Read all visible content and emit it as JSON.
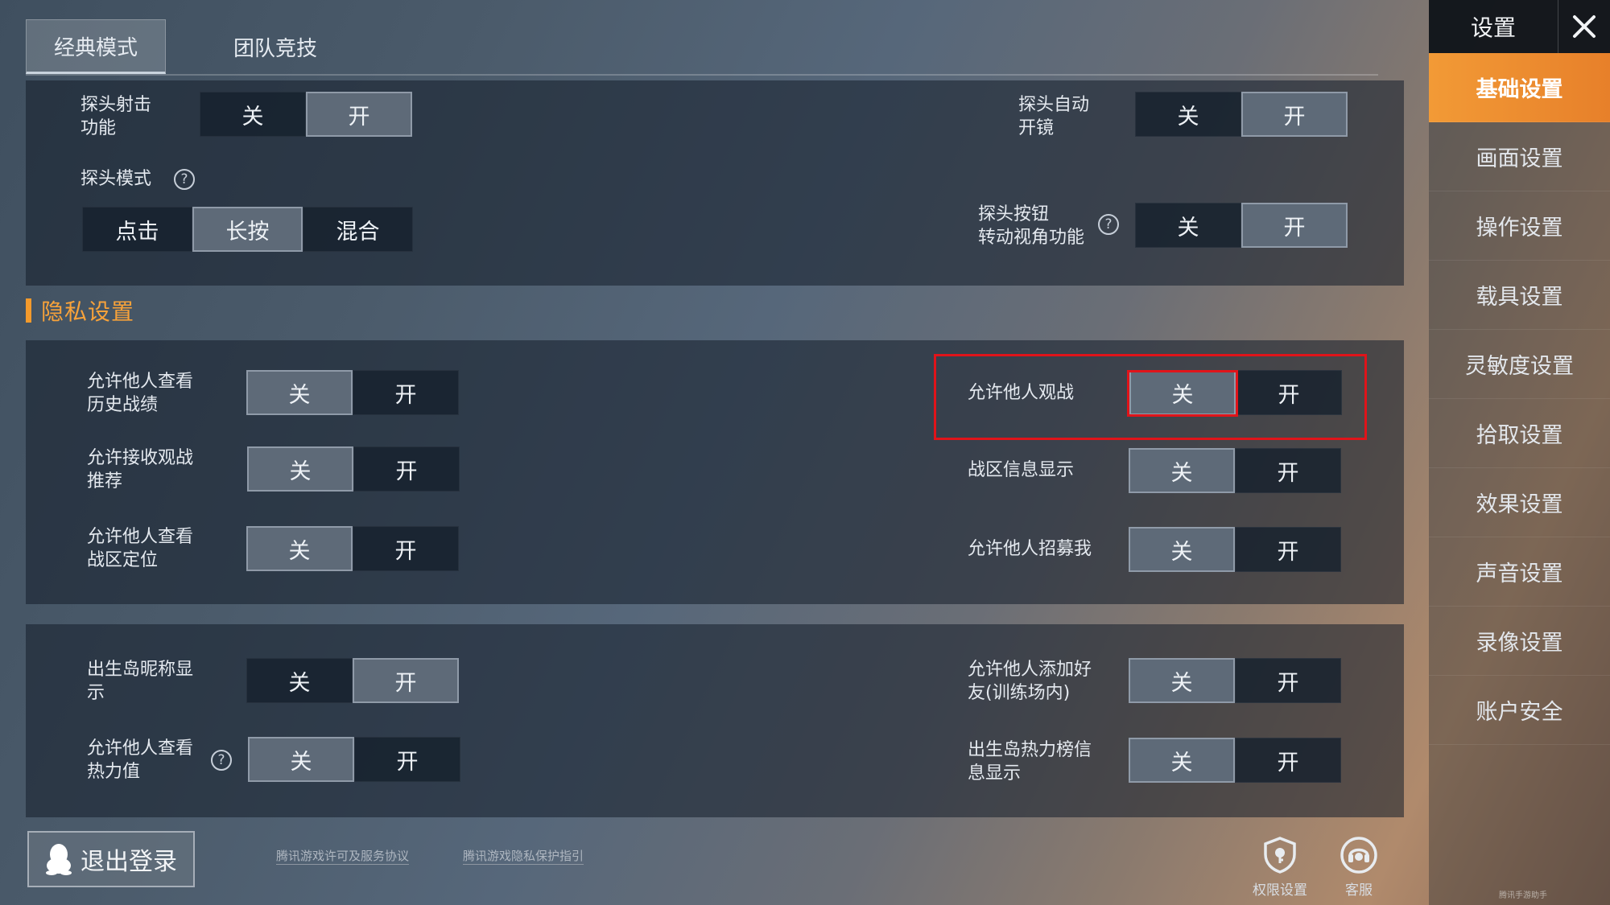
{
  "tabs": [
    {
      "label": "经典模式",
      "active": true
    },
    {
      "label": "团队竞技",
      "active": false
    }
  ],
  "common": {
    "off": "关",
    "on": "开"
  },
  "peek": {
    "shoot_label": "探头射击\n功能",
    "shoot_value": "开",
    "auto_scope_label": "探头自动\n开镜",
    "auto_scope_value": "开",
    "mode_label": "探头模式",
    "mode_options": [
      "点击",
      "长按",
      "混合"
    ],
    "mode_value": "长按",
    "button_view_label": "探头按钮\n转动视角功能",
    "button_view_value": "开"
  },
  "privacy": {
    "title": "隐私设置",
    "rows": [
      {
        "label": "允许他人查看\n历史战绩",
        "value": "关"
      },
      {
        "label": "允许接收观战\n推荐",
        "value": "关"
      },
      {
        "label": "允许他人查看\n战区定位",
        "value": "关"
      },
      {
        "label": "允许他人观战",
        "value": "关"
      },
      {
        "label": "战区信息显示",
        "value": "关"
      },
      {
        "label": "允许他人招募我",
        "value": "关"
      }
    ]
  },
  "island": {
    "rows": [
      {
        "label": "出生岛昵称显\n示",
        "value": "开"
      },
      {
        "label": "允许他人查看\n热力值",
        "value": "关"
      },
      {
        "label": "允许他人添加好\n友(训练场内)",
        "value": "关"
      },
      {
        "label": "出生岛热力榜信\n息显示",
        "value": "关"
      }
    ]
  },
  "sidebar": {
    "title": "设置",
    "items": [
      "基础设置",
      "画面设置",
      "操作设置",
      "载具设置",
      "灵敏度设置",
      "拾取设置",
      "效果设置",
      "声音设置",
      "录像设置",
      "账户安全"
    ],
    "active": "基础设置"
  },
  "footer": {
    "logout": "退出登录",
    "link1": "腾讯游戏许可及服务协议",
    "link2": "腾讯游戏隐私保护指引",
    "permissions": "权限设置",
    "service": "客服",
    "watermark": "腾讯手游助手"
  },
  "colors": {
    "accent": "#f39a2c",
    "highlight": "#e0141a",
    "selected": "#5e6a78"
  }
}
